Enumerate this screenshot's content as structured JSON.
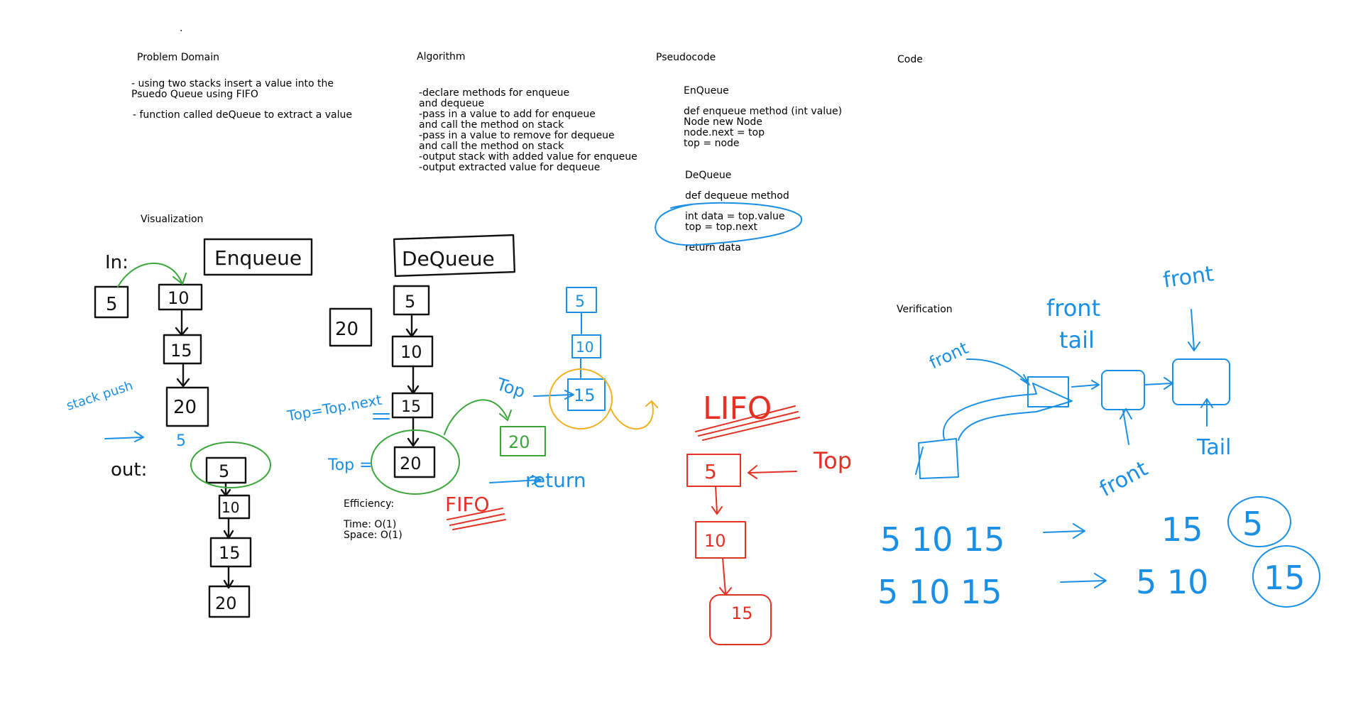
{
  "dot": ".",
  "problem_domain": {
    "heading": "Problem Domain",
    "bullet_1": "- using two stacks insert a value into the\nPsuedo Queue using FIFO",
    "bullet_2": "- function called deQueue to extract a value"
  },
  "algorithm": {
    "heading": "Algorithm",
    "lines": "-declare methods for enqueue\nand dequeue\n-pass in a value to add for enqueue\nand call the method on stack\n-pass in a value to remove for dequeue\nand call the method on stack\n-output stack with added value for enqueue\n-output extracted value for dequeue"
  },
  "pseudocode": {
    "heading": "Pseudocode",
    "enqueue_title": "EnQueue",
    "enqueue_body": "def enqueue method (int value)\nNode new Node\nnode.next = top\ntop = node",
    "dequeue_title": "DeQueue",
    "dequeue_def": "def dequeue method",
    "dequeue_body": "int data = top.value\ntop = top.next",
    "dequeue_return": "return data"
  },
  "code": {
    "heading": "Code"
  },
  "visualization": {
    "heading": "Visualization",
    "efficiency_title": "Efficiency:",
    "efficiency_body": "Time: O(1)\nSpace: O(1)"
  },
  "verification": {
    "heading": "Verification"
  },
  "handwriting": {
    "in_label": "In:",
    "out_label": "out:",
    "enqueue_box": "Enqueue",
    "dequeue_box": "DeQueue",
    "in_values": [
      "5",
      "10",
      "15",
      "20"
    ],
    "out_values": [
      "5",
      "10",
      "15",
      "20"
    ],
    "stack_note": "stack push",
    "arrow_value": "5",
    "deq_values": [
      "5",
      "10",
      "15",
      "20"
    ],
    "deq_side_value": "20",
    "top_eq_next": "Top=Top.next",
    "top_eq": "Top =",
    "top_label": "Top",
    "popped_value": "20",
    "return_label": "return",
    "fifo_mid": "FIFO",
    "blue_stack": [
      "5",
      "10",
      "15"
    ],
    "lifo_label": "LIFO",
    "red_stack": [
      "5",
      "10",
      "15"
    ],
    "red_top": "Top",
    "front_labels": [
      "front",
      "front",
      "front",
      "front"
    ],
    "tail_labels": [
      "tail",
      "Tail"
    ],
    "seq_1_left": "5 10 15",
    "seq_1_right": "15",
    "seq_1_circled": "5",
    "seq_2_left": "5 10 15",
    "seq_2_right": "5 10",
    "seq_2_circled": "15"
  },
  "colors": {
    "ink_black": "#111111",
    "ink_green": "#3aa63a",
    "ink_blue": "#1a8fe3",
    "ink_red": "#e53024",
    "ink_yellow": "#f2b020"
  }
}
